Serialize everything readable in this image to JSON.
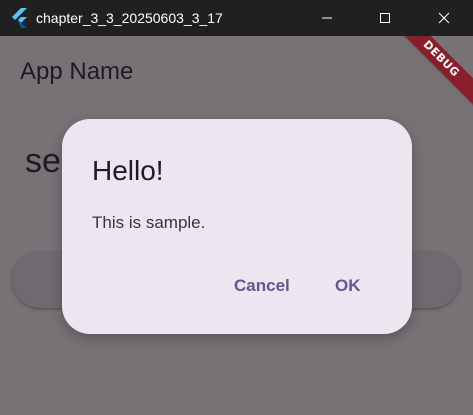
{
  "window": {
    "title": "chapter_3_3_20250603_3_17"
  },
  "app": {
    "appbar_title": "App Name",
    "body_text": "se",
    "debug_banner": "DEBUG"
  },
  "dialog": {
    "title": "Hello!",
    "message": "This is sample.",
    "cancel_label": "Cancel",
    "ok_label": "OK"
  },
  "colors": {
    "titlebar": "#202020",
    "scrim_background": "#777275",
    "dialog_surface": "#ede6f1",
    "dialog_action": "#65558f",
    "debug_banner": "#8a1e2b"
  },
  "icons": {
    "app": "flutter-logo-icon",
    "minimize": "minimize-icon",
    "maximize": "maximize-icon",
    "close": "close-icon"
  }
}
